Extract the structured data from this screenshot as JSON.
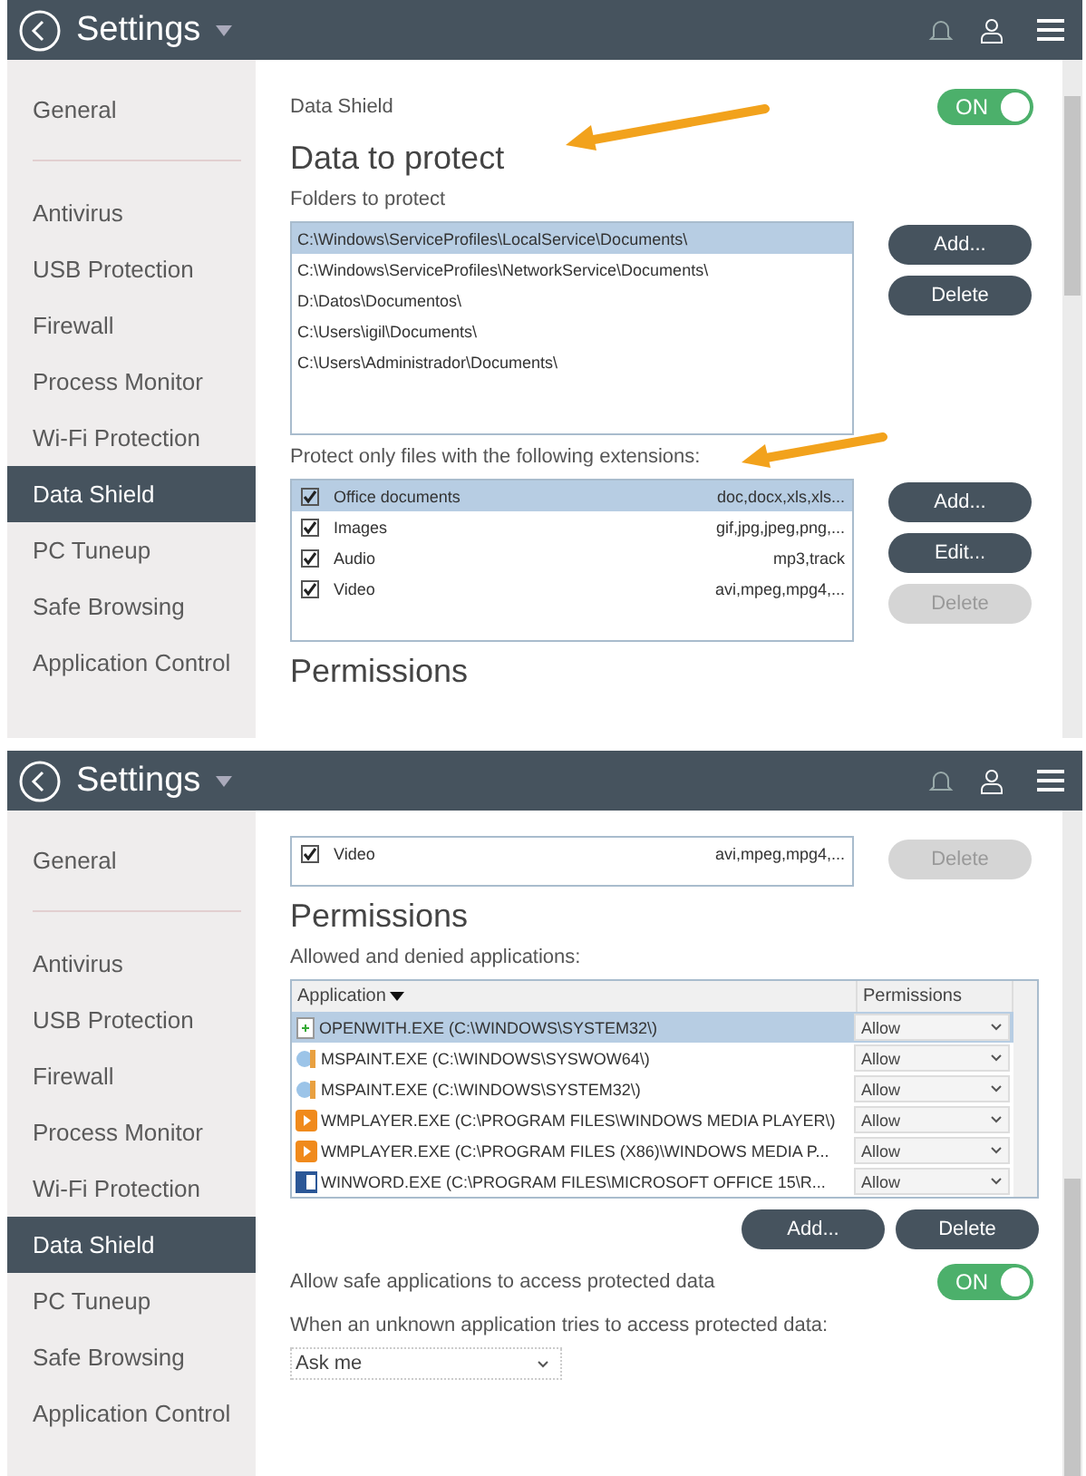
{
  "panels": [
    {
      "header": {
        "title": "Settings"
      },
      "sidebar": {
        "items": [
          {
            "label": "General",
            "selected": false
          },
          {
            "label": "Antivirus",
            "selected": false
          },
          {
            "label": "USB Protection",
            "selected": false
          },
          {
            "label": "Firewall",
            "selected": false
          },
          {
            "label": "Process Monitor",
            "selected": false
          },
          {
            "label": "Wi-Fi Protection",
            "selected": false
          },
          {
            "label": "Data Shield",
            "selected": true
          },
          {
            "label": "PC Tuneup",
            "selected": false
          },
          {
            "label": "Safe Browsing",
            "selected": false
          },
          {
            "label": "Application Control",
            "selected": false
          }
        ]
      },
      "blocks": [
        {
          "kind": "toggle",
          "label": "Data Shield",
          "on": true,
          "text": "ON"
        },
        {
          "kind": "heading",
          "text": "Data to protect",
          "arrow": true
        },
        {
          "kind": "label",
          "text": "Folders to protect"
        },
        {
          "kind": "list",
          "rows": [
            {
              "text": "C:\\Windows\\ServiceProfiles\\LocalService\\Documents\\",
              "selected": true
            },
            {
              "text": "C:\\Windows\\ServiceProfiles\\NetworkService\\Documents\\",
              "selected": false
            },
            {
              "text": "D:\\Datos\\Documentos\\",
              "selected": false
            },
            {
              "text": "C:\\Users\\igil\\Documents\\",
              "selected": false
            },
            {
              "text": "C:\\Users\\Administrador\\Documents\\",
              "selected": false
            }
          ],
          "buttons": [
            {
              "label": "Add...",
              "disabled": false
            },
            {
              "label": "Delete",
              "disabled": false
            }
          ]
        },
        {
          "kind": "label",
          "text": "Protect only files with the following extensions:",
          "arrow": true
        },
        {
          "kind": "checklist",
          "rows": [
            {
              "name": "Office documents",
              "extensions": "doc,docx,xls,xls...",
              "checked": true,
              "selected": true
            },
            {
              "name": "Images",
              "extensions": "gif,jpg,jpeg,png,...",
              "checked": true,
              "selected": false
            },
            {
              "name": "Audio",
              "extensions": "mp3,track",
              "checked": true,
              "selected": false
            },
            {
              "name": "Video",
              "extensions": "avi,mpeg,mpg4,...",
              "checked": true,
              "selected": false
            }
          ],
          "buttons": [
            {
              "label": "Add...",
              "disabled": false
            },
            {
              "label": "Edit...",
              "disabled": false
            },
            {
              "label": "Delete",
              "disabled": true
            }
          ]
        },
        {
          "kind": "heading",
          "text": "Permissions",
          "arrow": false
        }
      ]
    },
    {
      "header": {
        "title": "Settings"
      },
      "sidebar": {
        "items": [
          {
            "label": "General",
            "selected": false
          },
          {
            "label": "Antivirus",
            "selected": false
          },
          {
            "label": "USB Protection",
            "selected": false
          },
          {
            "label": "Firewall",
            "selected": false
          },
          {
            "label": "Process Monitor",
            "selected": false
          },
          {
            "label": "Wi-Fi Protection",
            "selected": false
          },
          {
            "label": "Data Shield",
            "selected": true
          },
          {
            "label": "PC Tuneup",
            "selected": false
          },
          {
            "label": "Safe Browsing",
            "selected": false
          },
          {
            "label": "Application Control",
            "selected": false
          }
        ]
      },
      "blocks": [
        {
          "kind": "checklist",
          "rows": [
            {
              "name": "Video",
              "extensions": "avi,mpeg,mpg4,...",
              "checked": true,
              "selected": false
            }
          ],
          "buttons": [
            {
              "label": "Delete",
              "disabled": true
            }
          ]
        },
        {
          "kind": "heading",
          "text": "Permissions",
          "arrow": false
        },
        {
          "kind": "label",
          "text": "Allowed and denied applications:"
        },
        {
          "kind": "table",
          "columns": [
            "Application",
            "Permissions"
          ],
          "rows": [
            {
              "kind": "doc",
              "app": "OPENWITH.EXE (C:\\WINDOWS\\SYSTEM32\\)",
              "permission": "Allow",
              "selected": true
            },
            {
              "kind": "paint",
              "app": "MSPAINT.EXE (C:\\WINDOWS\\SYSWOW64\\)",
              "permission": "Allow",
              "selected": false
            },
            {
              "kind": "paint",
              "app": "MSPAINT.EXE (C:\\WINDOWS\\SYSTEM32\\)",
              "permission": "Allow",
              "selected": false
            },
            {
              "kind": "media",
              "app": "WMPLAYER.EXE (C:\\PROGRAM FILES\\WINDOWS MEDIA PLAYER\\)",
              "permission": "Allow",
              "selected": false
            },
            {
              "kind": "media",
              "app": "WMPLAYER.EXE (C:\\PROGRAM FILES (X86)\\WINDOWS MEDIA P...",
              "permission": "Allow",
              "selected": false
            },
            {
              "kind": "word",
              "app": "WINWORD.EXE (C:\\PROGRAM FILES\\MICROSOFT OFFICE 15\\R...",
              "permission": "Allow",
              "selected": false
            }
          ],
          "buttons": [
            {
              "label": "Add...",
              "disabled": false
            },
            {
              "label": "Delete",
              "disabled": false
            }
          ]
        },
        {
          "kind": "toggle",
          "label": "Allow safe applications to access protected data",
          "on": true,
          "text": "ON"
        },
        {
          "kind": "label",
          "text": "When an unknown application tries to access protected data:"
        },
        {
          "kind": "select",
          "value": "Ask me"
        }
      ]
    }
  ]
}
